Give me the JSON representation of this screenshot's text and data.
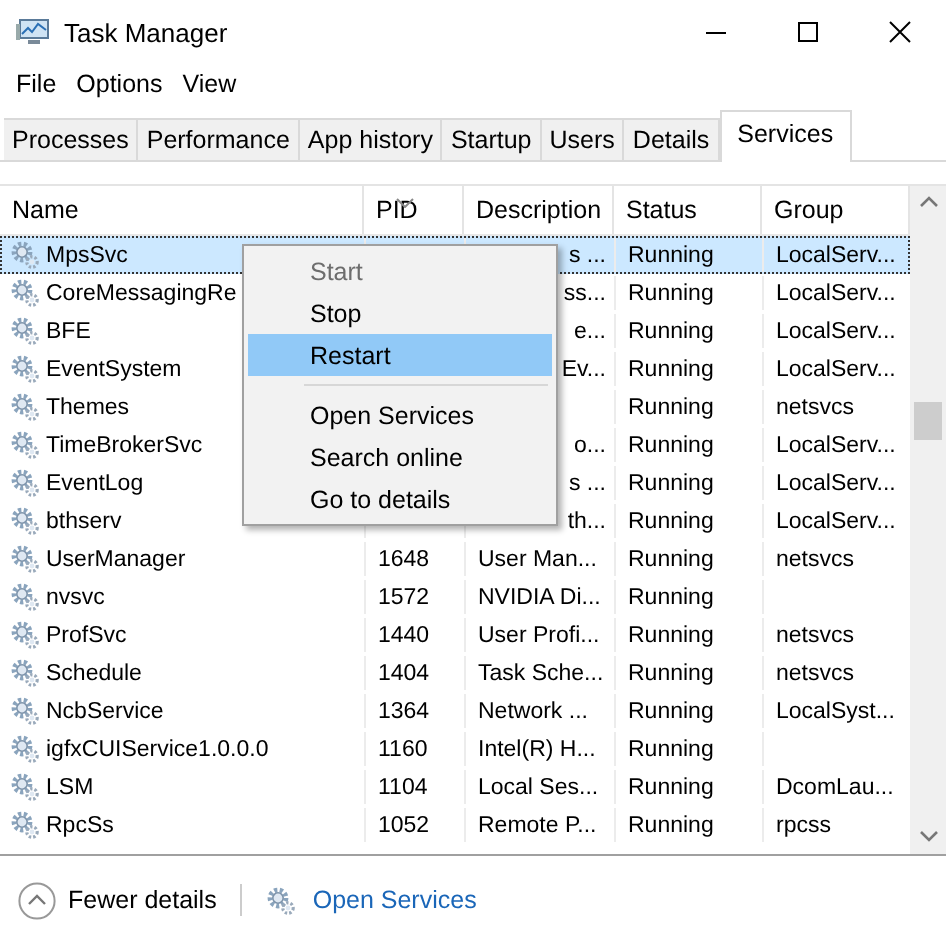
{
  "window": {
    "title": "Task Manager"
  },
  "menu_bar": [
    "File",
    "Options",
    "View"
  ],
  "tabs": [
    {
      "label": "Processes",
      "selected": false
    },
    {
      "label": "Performance",
      "selected": false
    },
    {
      "label": "App history",
      "selected": false
    },
    {
      "label": "Startup",
      "selected": false
    },
    {
      "label": "Users",
      "selected": false
    },
    {
      "label": "Details",
      "selected": false
    },
    {
      "label": "Services",
      "selected": true
    }
  ],
  "table": {
    "columns": [
      {
        "label": "Name",
        "sorted": false
      },
      {
        "label": "PID",
        "sorted": true
      },
      {
        "label": "Description",
        "sorted": false
      },
      {
        "label": "Status",
        "sorted": false
      },
      {
        "label": "Group",
        "sorted": false
      }
    ],
    "rows": [
      {
        "name": "MpsSvc",
        "description": "s ...",
        "status": "Running",
        "group": "LocalServ...",
        "selected": true
      },
      {
        "name": "CoreMessagingRe",
        "description": "ss...",
        "status": "Running",
        "group": "LocalServ...",
        "selected": false
      },
      {
        "name": "BFE",
        "description": "e...",
        "status": "Running",
        "group": "LocalServ...",
        "selected": false
      },
      {
        "name": "EventSystem",
        "description": "Ev...",
        "status": "Running",
        "group": "LocalServ...",
        "selected": false
      },
      {
        "name": "Themes",
        "status": "Running",
        "group": "netsvcs",
        "selected": false
      },
      {
        "name": "TimeBrokerSvc",
        "description": "o...",
        "status": "Running",
        "group": "LocalServ...",
        "selected": false
      },
      {
        "name": "EventLog",
        "description": "s ...",
        "status": "Running",
        "group": "LocalServ...",
        "selected": false
      },
      {
        "name": "bthserv",
        "description": "th...",
        "status": "Running",
        "group": "LocalServ...",
        "selected": false
      },
      {
        "name": "UserManager",
        "pid": "1648",
        "description": "User Man...",
        "status": "Running",
        "group": "netsvcs",
        "selected": false
      },
      {
        "name": "nvsvc",
        "pid": "1572",
        "description": "NVIDIA Di...",
        "status": "Running",
        "selected": false
      },
      {
        "name": "ProfSvc",
        "pid": "1440",
        "description": "User Profi...",
        "status": "Running",
        "group": "netsvcs",
        "selected": false
      },
      {
        "name": "Schedule",
        "pid": "1404",
        "description": "Task Sche...",
        "status": "Running",
        "group": "netsvcs",
        "selected": false
      },
      {
        "name": "NcbService",
        "pid": "1364",
        "description": "Network ...",
        "status": "Running",
        "group": "LocalSyst...",
        "selected": false
      },
      {
        "name": "igfxCUIService1.0.0.0",
        "pid": "1160",
        "description": "Intel(R) H...",
        "status": "Running",
        "selected": false
      },
      {
        "name": "LSM",
        "pid": "1104",
        "description": "Local Ses...",
        "status": "Running",
        "group": "DcomLau...",
        "selected": false
      },
      {
        "name": "RpcSs",
        "pid": "1052",
        "description": "Remote P...",
        "status": "Running",
        "group": "rpcss",
        "selected": false
      }
    ]
  },
  "context_menu": {
    "items": [
      {
        "kind": "item",
        "label": "Start",
        "disabled": true,
        "selected": false
      },
      {
        "kind": "item",
        "label": "Stop",
        "disabled": false,
        "selected": false
      },
      {
        "kind": "item",
        "label": "Restart",
        "disabled": false,
        "selected": true
      },
      {
        "kind": "separator"
      },
      {
        "kind": "item",
        "label": "Open Services",
        "disabled": false,
        "selected": false
      },
      {
        "kind": "item",
        "label": "Search online",
        "disabled": false,
        "selected": false
      },
      {
        "kind": "item",
        "label": "Go to details",
        "disabled": false,
        "selected": false
      }
    ]
  },
  "footer": {
    "toggle": "Fewer details",
    "link": "Open Services"
  }
}
